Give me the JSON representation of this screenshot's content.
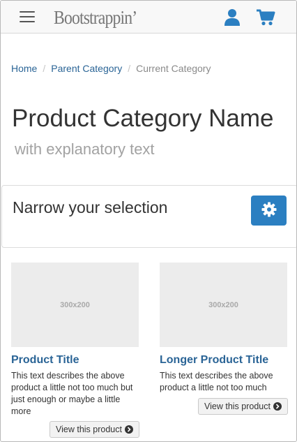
{
  "navbar": {
    "brand": "Bootstrappin’"
  },
  "breadcrumb": {
    "home": "Home",
    "parent": "Parent Category",
    "current": "Current Category",
    "separator": "/"
  },
  "page": {
    "title": "Product Category Name",
    "subtitle": "with explanatory text"
  },
  "filter_panel": {
    "title": "Narrow your selection",
    "button_color": "#2b7fc1"
  },
  "products": [
    {
      "image_placeholder": "300x200",
      "title": "Product Title",
      "description": "This text describes the above product a little not too much but just enough or maybe a little more",
      "button_label": "View this product"
    },
    {
      "image_placeholder": "300x200",
      "title": "Longer Product Title",
      "description": "This text describes the above product a little not too much",
      "button_label": "View this product"
    }
  ],
  "colors": {
    "link": "#2a6496",
    "accent": "#2b7fc1",
    "muted": "#a2a2a2"
  },
  "icons": {
    "menu": "hamburger-menu-icon",
    "user": "user-icon",
    "cart": "shopping-cart-icon",
    "settings": "gear-icon",
    "chevron": "chevron-right-circle-icon"
  }
}
